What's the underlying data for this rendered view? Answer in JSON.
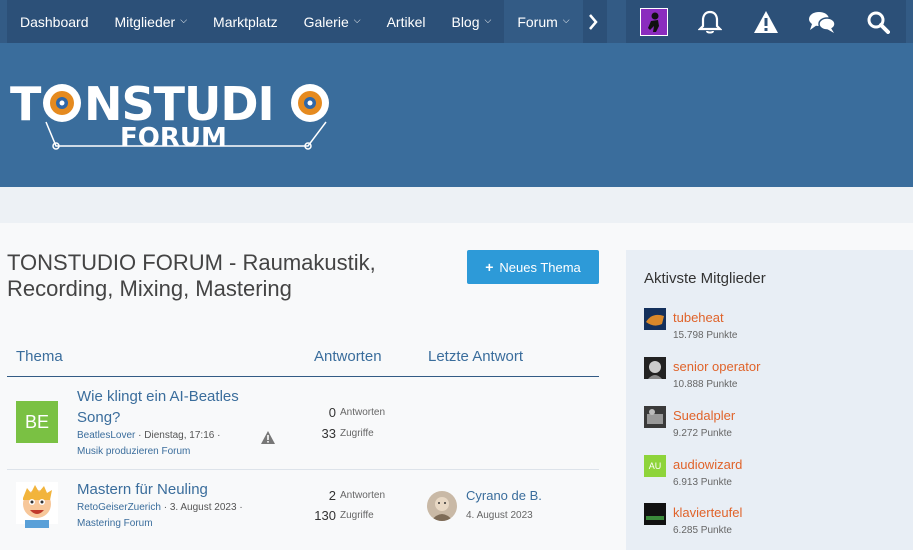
{
  "nav": {
    "items": [
      {
        "label": "Dashboard",
        "dropdown": false
      },
      {
        "label": "Mitglieder",
        "dropdown": true
      },
      {
        "label": "Marktplatz",
        "dropdown": false
      },
      {
        "label": "Galerie",
        "dropdown": true
      },
      {
        "label": "Artikel",
        "dropdown": false
      },
      {
        "label": "Blog",
        "dropdown": true
      },
      {
        "label": "Forum",
        "dropdown": true
      }
    ],
    "icons": [
      "user-avatar",
      "bell-icon",
      "warning-icon",
      "chat-icon",
      "search-icon"
    ]
  },
  "logo": {
    "main": "TONSTUDIO",
    "sub": "FORUM"
  },
  "page": {
    "title": "TONSTUDIO FORUM - Raumakustik, Recording, Mixing, Mastering",
    "new_thread_label": "Neues Thema"
  },
  "table": {
    "col_topic": "Thema",
    "col_replies": "Antworten",
    "col_last": "Letzte Antwort",
    "rows": [
      {
        "avatar_text": "BE",
        "avatar_color": "#7ac143",
        "title_line1": "Wie klingt ein AI-Beatles",
        "title_line2": "Song?",
        "author": "BeatlesLover",
        "date": "Dienstag, 17:16",
        "forum": "Musik produzieren Forum",
        "replies": "0",
        "replies_label": "Antworten",
        "views": "33",
        "views_label": "Zugriffe",
        "last_user": "",
        "last_date": ""
      },
      {
        "avatar_text": "",
        "title_line1": "Mastern für Neuling",
        "author": "RetoGeiserZuerich",
        "date": "3. August 2023",
        "forum": "Mastering Forum",
        "replies": "2",
        "replies_label": "Antworten",
        "views": "130",
        "views_label": "Zugriffe",
        "last_user": "Cyrano de B.",
        "last_date": "4. August 2023"
      }
    ]
  },
  "sidebar": {
    "title": "Aktivste Mitglieder",
    "members": [
      {
        "name": "tubeheat",
        "points": "15.798 Punkte"
      },
      {
        "name": "senior operator",
        "points": "10.888 Punkte"
      },
      {
        "name": "Suedalpler",
        "points": "9.272 Punkte"
      },
      {
        "name": "audiowizard",
        "points": "6.913 Punkte",
        "avatar_text": "AU"
      },
      {
        "name": "klavierteufel",
        "points": "6.285 Punkte"
      }
    ]
  }
}
